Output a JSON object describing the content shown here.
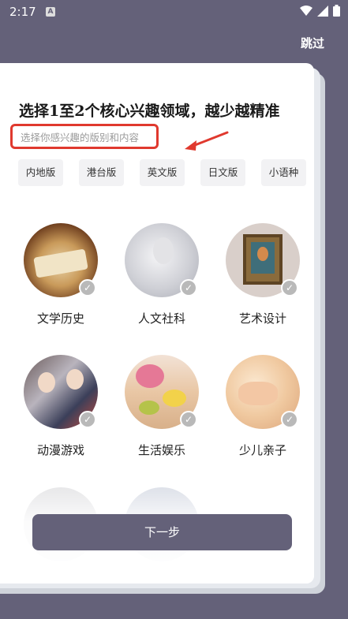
{
  "status_bar": {
    "time": "2:17",
    "notification_icon": "A"
  },
  "header": {
    "skip_label": "跳过"
  },
  "card": {
    "title": "选择1至2个核心兴趣领域，越少越精准",
    "subtitle": "选择你感兴趣的版别和内容"
  },
  "chips": [
    "内地版",
    "港台版",
    "英文版",
    "日文版",
    "小语种"
  ],
  "interests": [
    {
      "label": "文学历史",
      "icon": "open-book-image"
    },
    {
      "label": "人文社科",
      "icon": "statue-image"
    },
    {
      "label": "艺术设计",
      "icon": "portrait-painting-image"
    },
    {
      "label": "动漫游戏",
      "icon": "anime-characters-image"
    },
    {
      "label": "生活娱乐",
      "icon": "flowers-table-image"
    },
    {
      "label": "少儿亲子",
      "icon": "baby-hand-image"
    }
  ],
  "next_button_label": "下一步",
  "colors": {
    "accent": "#646179",
    "highlight": "#e0392e"
  }
}
